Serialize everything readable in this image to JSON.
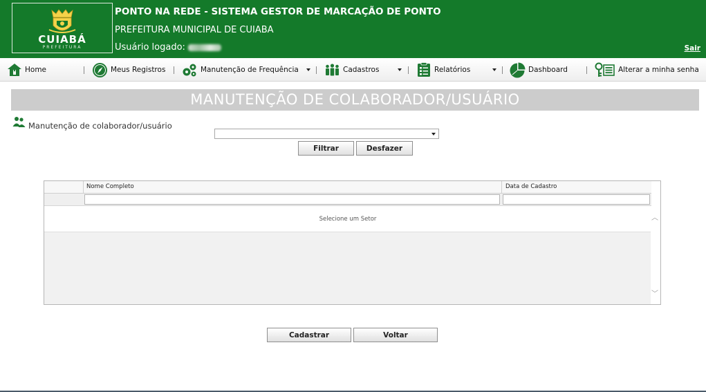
{
  "header": {
    "logo_text": "CUIABÁ",
    "logo_sub": "PREFEITURA",
    "system_title": "PONTO NA REDE - SISTEMA GESTOR DE MARCAÇÃO DE PONTO",
    "org_name": "PREFEITURA MUNICIPAL DE CUIABA",
    "user_label": "Usuário logado:",
    "logout_label": "Sair"
  },
  "nav": {
    "items": [
      {
        "label": "Home",
        "icon": "home-icon"
      },
      {
        "label": "Meus Registros",
        "icon": "compass-icon"
      },
      {
        "label": "Manutenção de Frequência",
        "icon": "gears-icon"
      },
      {
        "label": "Cadastros",
        "icon": "people-icon"
      },
      {
        "label": "Relatórios",
        "icon": "report-icon"
      },
      {
        "label": "Dashboard",
        "icon": "pie-chart-icon"
      },
      {
        "label": "Alterar a minha senha",
        "icon": "key-icon"
      }
    ]
  },
  "page": {
    "title": "MANUTENÇÃO DE COLABORADOR/USUÁRIO",
    "section_label": "Manutenção de colaborador/usuário",
    "setor_select_value": "",
    "filter_button": "Filtrar",
    "undo_button": "Desfazer"
  },
  "grid": {
    "columns": [
      "Nome Completo",
      "Data de Cadastro"
    ],
    "empty_message": "Selecione um Setor"
  },
  "actions": {
    "register_button": "Cadastrar",
    "back_button": "Voltar"
  },
  "colors": {
    "header_green": "#147a2a",
    "title_bar_gray": "#cccccc",
    "icon_green": "#1f7a34"
  }
}
